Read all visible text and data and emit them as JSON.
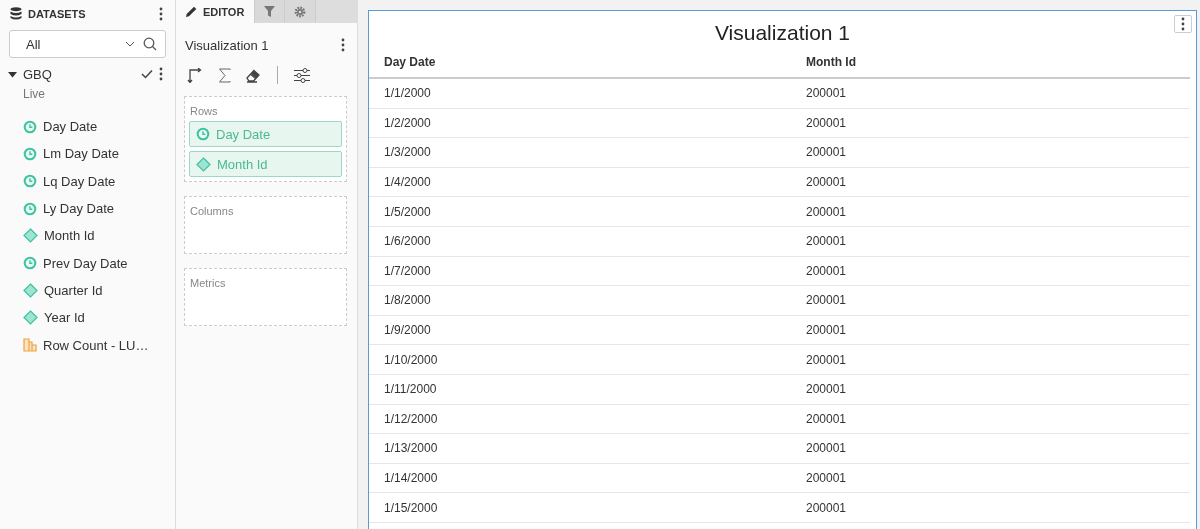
{
  "sidebar": {
    "title": "DATASETS",
    "filter": {
      "value": "All"
    },
    "dataset": {
      "name": "GBQ",
      "expanded": true,
      "checked": true,
      "mode": "Live"
    },
    "fields": [
      {
        "label": "Day Date",
        "kind": "date"
      },
      {
        "label": "Lm Day Date",
        "kind": "date"
      },
      {
        "label": "Lq Day Date",
        "kind": "date"
      },
      {
        "label": "Ly Day Date",
        "kind": "date"
      },
      {
        "label": "Month Id",
        "kind": "dimension"
      },
      {
        "label": "Prev Day Date",
        "kind": "date"
      },
      {
        "label": "Quarter Id",
        "kind": "dimension"
      },
      {
        "label": "Year Id",
        "kind": "dimension"
      },
      {
        "label": "Row Count - LU…",
        "kind": "metric"
      }
    ]
  },
  "editor": {
    "tabs": [
      {
        "kind": "editor",
        "label": "EDITOR",
        "selected": true
      },
      {
        "kind": "filter",
        "selected": false
      },
      {
        "kind": "settings",
        "selected": false
      }
    ],
    "title": "Visualization 1",
    "zones": [
      {
        "label": "Rows",
        "fields": [
          {
            "label": "Day Date",
            "kind": "date"
          },
          {
            "label": "Month Id",
            "kind": "dimension"
          }
        ]
      },
      {
        "label": "Columns"
      },
      {
        "label": "Metrics"
      }
    ]
  },
  "visualization": {
    "title": "Visualization 1",
    "table": {
      "columns": [
        "Day Date",
        "Month Id"
      ],
      "rows": [
        [
          "1/1/2000",
          "200001"
        ],
        [
          "1/2/2000",
          "200001"
        ],
        [
          "1/3/2000",
          "200001"
        ],
        [
          "1/4/2000",
          "200001"
        ],
        [
          "1/5/2000",
          "200001"
        ],
        [
          "1/6/2000",
          "200001"
        ],
        [
          "1/7/2000",
          "200001"
        ],
        [
          "1/8/2000",
          "200001"
        ],
        [
          "1/9/2000",
          "200001"
        ],
        [
          "1/10/2000",
          "200001"
        ],
        [
          "1/11/2000",
          "200001"
        ],
        [
          "1/12/2000",
          "200001"
        ],
        [
          "1/13/2000",
          "200001"
        ],
        [
          "1/14/2000",
          "200001"
        ],
        [
          "1/15/2000",
          "200001"
        ]
      ]
    }
  }
}
